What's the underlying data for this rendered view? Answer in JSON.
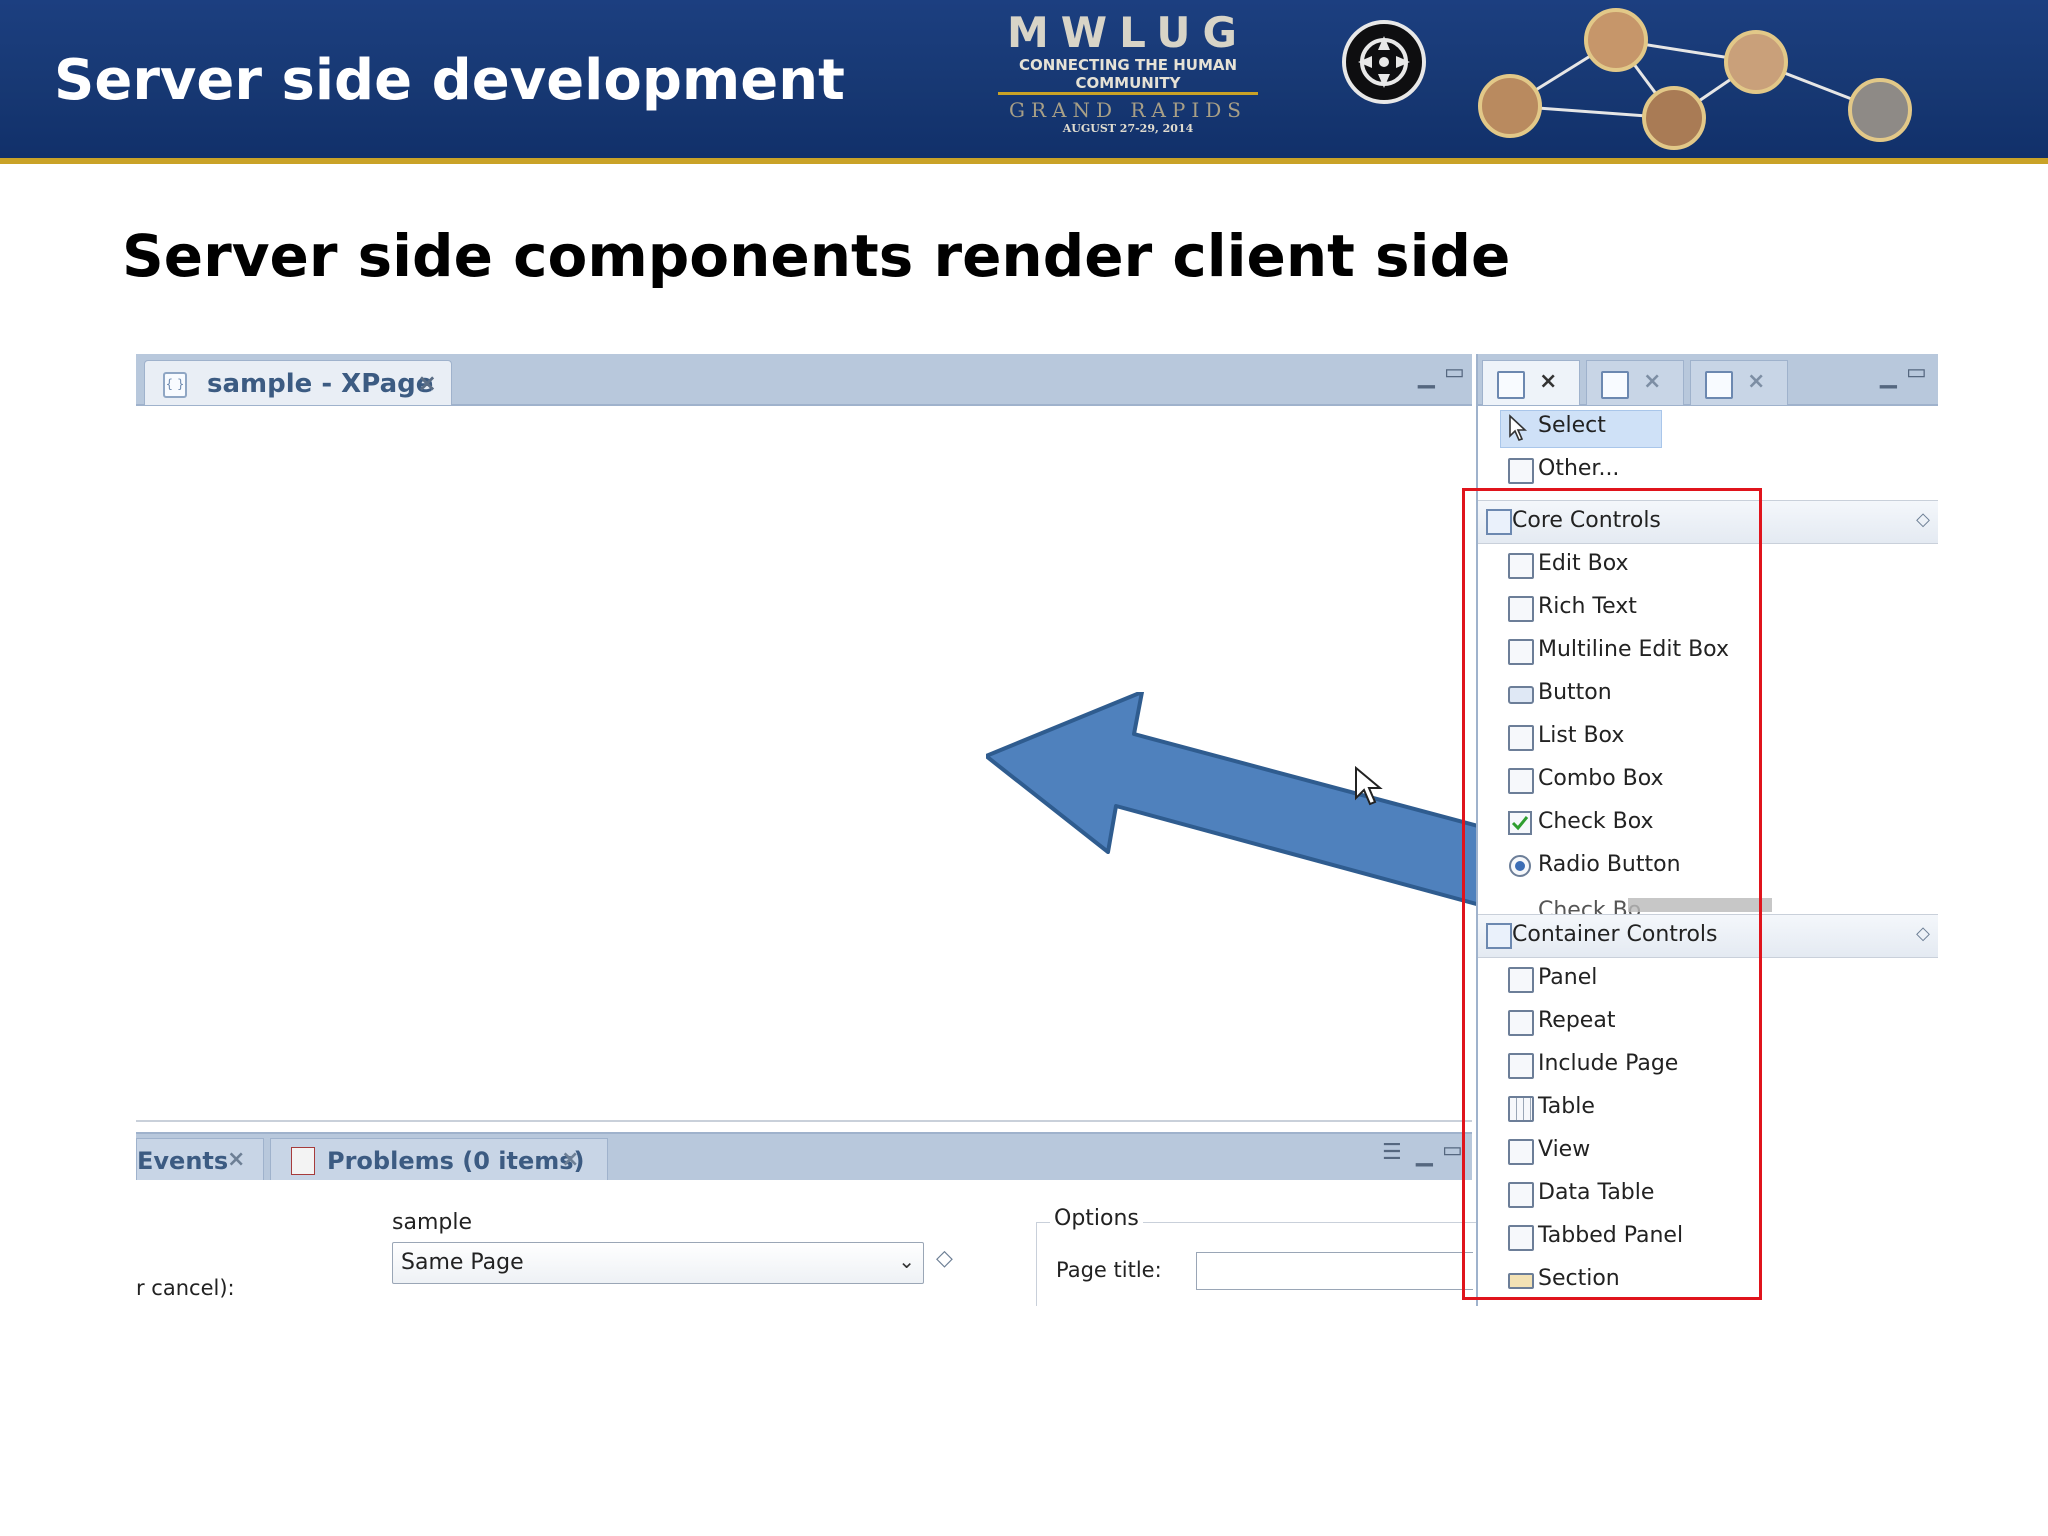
{
  "header": {
    "title": "Server side development",
    "logo": {
      "letters": "MWLUG",
      "tagline_line1": "CONNECTING THE HUMAN",
      "tagline_line2": "COMMUNITY",
      "city": "GRAND RAPIDS",
      "dates": "AUGUST 27-29, 2014"
    },
    "brand_color": "#173873",
    "accent_color": "#c9a227"
  },
  "slide": {
    "subtitle": "Server side components render client side"
  },
  "editor": {
    "tab_label": "sample - XPage",
    "tab_close": "×",
    "min_icon": "minimize-icon",
    "max_icon": "maximize-icon"
  },
  "bottom_panel": {
    "tabs": [
      {
        "label": "Events",
        "close": "×"
      },
      {
        "label": "Problems (0 items)",
        "close": "×"
      }
    ],
    "menu_glyph": "☰",
    "name_value": "sample",
    "cancel_label": "r cancel):",
    "next_page_select": "Same Page",
    "options_legend": "Options",
    "page_title_label": "Page title:",
    "page_title_value": ""
  },
  "palette": {
    "top_items": [
      {
        "label": "Select",
        "icon": "pointer-icon",
        "selected": true
      },
      {
        "label": "Other...",
        "icon": "other-controls-icon"
      }
    ],
    "core_controls": {
      "header": "Core Controls",
      "items": [
        {
          "label": "Edit Box",
          "icon": "edit-box-icon"
        },
        {
          "label": "Rich Text",
          "icon": "rich-text-icon"
        },
        {
          "label": "Multiline Edit Box",
          "icon": "multiline-edit-box-icon"
        },
        {
          "label": "Button",
          "icon": "button-icon"
        },
        {
          "label": "List Box",
          "icon": "list-box-icon"
        },
        {
          "label": "Combo Box",
          "icon": "combo-box-icon"
        },
        {
          "label": "Check Box",
          "icon": "check-box-icon"
        },
        {
          "label": "Radio Button",
          "icon": "radio-button-icon"
        }
      ],
      "cutoff_item": "Check Bo"
    },
    "container_controls": {
      "header": "Container Controls",
      "items": [
        {
          "label": "Panel",
          "icon": "panel-icon"
        },
        {
          "label": "Repeat",
          "icon": "repeat-icon"
        },
        {
          "label": "Include Page",
          "icon": "include-page-icon"
        },
        {
          "label": "Table",
          "icon": "table-icon"
        },
        {
          "label": "View",
          "icon": "view-icon"
        },
        {
          "label": "Data Table",
          "icon": "data-table-icon"
        },
        {
          "label": "Tabbed Panel",
          "icon": "tabbed-panel-icon"
        },
        {
          "label": "Section",
          "icon": "section-icon"
        }
      ]
    },
    "highlight_color": "#e0141c"
  },
  "annotation": {
    "arrow_color": "#4f81bd"
  }
}
